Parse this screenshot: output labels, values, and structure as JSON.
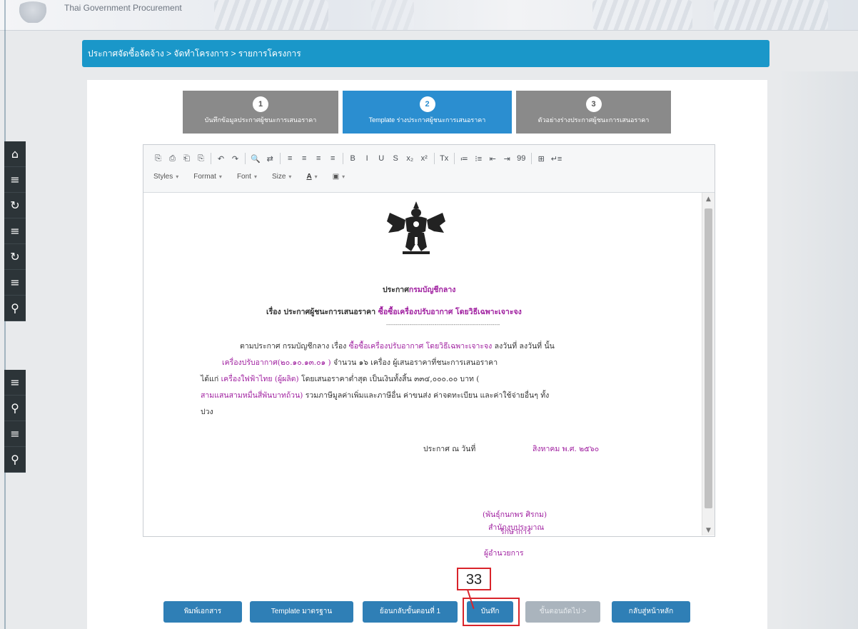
{
  "header": {
    "app_title": "Thai Government Procurement"
  },
  "breadcrumb": "ประกาศจัดซื้อจัดจ้าง > จัดทำโครงการ > รายการโครงการ",
  "sidebar": {
    "group1": [
      {
        "icon": "home-icon",
        "glyph": "⌂"
      },
      {
        "icon": "menu-icon",
        "glyph": "≡"
      },
      {
        "icon": "refresh-icon",
        "glyph": "↻"
      },
      {
        "icon": "menu-icon",
        "glyph": "≡"
      },
      {
        "icon": "refresh-icon",
        "glyph": "↻"
      },
      {
        "icon": "menu-icon",
        "glyph": "≡"
      },
      {
        "icon": "search-icon",
        "glyph": "⚲"
      }
    ],
    "group2": [
      {
        "icon": "menu-icon",
        "glyph": "≡"
      },
      {
        "icon": "search-icon",
        "glyph": "⚲"
      },
      {
        "icon": "menu-icon",
        "glyph": "≡"
      },
      {
        "icon": "search-icon",
        "glyph": "⚲"
      }
    ]
  },
  "steps": [
    {
      "num": "1",
      "label": "บันทึกข้อมูลประกาศผู้ชนะการเสนอราคา"
    },
    {
      "num": "2",
      "label": "Template ร่างประกาศผู้ชนะการเสนอราคา"
    },
    {
      "num": "3",
      "label": "ตัวอย่างร่างประกาศผู้ชนะการเสนอราคา"
    }
  ],
  "toolbar": {
    "row1": [
      "⎘",
      "⎙",
      "⎗",
      "⎘",
      "|",
      "↶",
      "↷",
      "|",
      "🔍",
      "⇄",
      "|",
      "≡",
      "≡",
      "≡",
      "≡",
      "|",
      "B",
      "I",
      "U",
      "S",
      "x₂",
      "x²",
      "|",
      "Tx",
      "|",
      "≔",
      "⁝≡",
      "⇤",
      "⇥",
      "99",
      "|",
      "⊞",
      "↵≡"
    ],
    "styles": "Styles",
    "format": "Format",
    "font": "Font",
    "size": "Size",
    "text_color": "A",
    "bg_color": "▣"
  },
  "document": {
    "title_prefix": "ประกาศ",
    "title_org": "กรมบัญชีกลาง",
    "subject_prefix": "เรื่อง ประกาศผู้ชนะการเสนอราคา",
    "subject_item": "ซื้อซื้อเครื่องปรับอากาศ โดยวิธีเฉพาะเจาะจง",
    "separator": "-----------------------------------------------------------",
    "para1_a": "ตามประกาศ กรมบัญชีกลาง เรื่อง",
    "para1_b": "ซื้อซื้อเครื่องปรับอากาศ โดยวิธีเฉพาะเจาะจง",
    "para1_c": "ลงวันที่ ลงวันที่  นั้น",
    "para2_a": "เครื่องปรับอากาศ(๒๐.๑๐.๑๓.๐๑ )",
    "para2_b": "จำนวน ๑๖ เครื่อง ผู้เสนอราคาที่ชนะการเสนอราคา",
    "para3_a": "ได้แก่",
    "para3_b": "เครื่องใฟฟ้าไทย (ผู้ผลิต)",
    "para3_c": "โดยเสนอราคาต่ำสุด เป็นเงินทั้งสิ้น ๓๓๔,๐๐๐.๐๐ บาท (",
    "para4_a": "สามแสนสามหมื่นสี่พันบาทถ้วน)",
    "para4_b": "รวมภาษีมูลค่าเพิ่มและภาษีอื่น ค่าขนส่ง ค่าจดทะเบียน และค่าใช้จ่ายอื่นๆ ทั้ง",
    "para5": "ปวง",
    "date_prefix": "ประกาศ ณ วันที่",
    "date_value": "สิงหาคม พ.ศ. ๒๕๖๐",
    "signer_name": "(พันธุ์กนกพร ศิรกม)",
    "signer_pos1": "รักษาการ",
    "signer_pos2": "ผู้อำนวยการ",
    "signer_pos3": "สำนักงบประมาณ"
  },
  "buttons": {
    "print": "พิมพ์เอกสาร",
    "template": "Template มาตรฐาน",
    "back": "ย้อนกลับขั้นตอนที่ 1",
    "save": "บันทึก",
    "next": "ขั้นตอนถัดไป >",
    "home": "กลับสู่หน้าหลัก"
  },
  "annotation": {
    "callout": "33"
  },
  "colors": {
    "breadcrumb_bg": "#1a97c9",
    "step_active": "#2b8ed0",
    "step_inactive": "#8a8a8a",
    "button": "#2f7fb6",
    "highlight": "#d9242b",
    "doc_accent": "#a020a0"
  }
}
